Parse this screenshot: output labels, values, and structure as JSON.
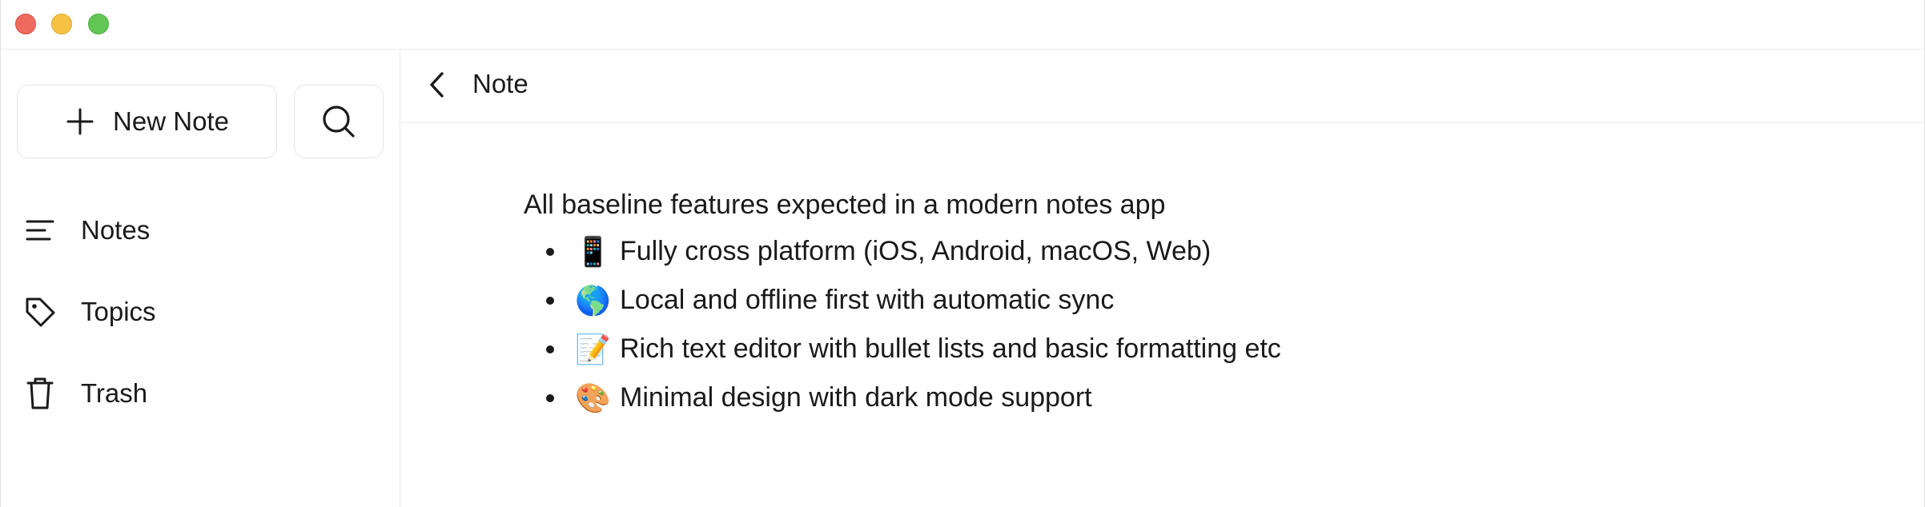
{
  "titlebar": {
    "buttons": [
      "close",
      "minimize",
      "zoom"
    ]
  },
  "sidebar": {
    "new_note_label": "New Note",
    "items": [
      {
        "label": "Notes",
        "icon": "list-icon"
      },
      {
        "label": "Topics",
        "icon": "tag-icon"
      },
      {
        "label": "Trash",
        "icon": "trash-icon"
      }
    ]
  },
  "main": {
    "header_title": "Note",
    "intro": "All baseline features expected in a modern notes app",
    "bullets": [
      {
        "emoji": "📱",
        "text": "Fully cross platform (iOS, Android, macOS, Web)"
      },
      {
        "emoji": "🌎",
        "text": "Local and offline first with automatic sync"
      },
      {
        "emoji": "📝",
        "text": "Rich text editor with bullet lists and basic formatting etc"
      },
      {
        "emoji": "🎨",
        "text": "Minimal design with dark mode support"
      }
    ]
  },
  "colors": {
    "close": "#ee6a5f",
    "minimize": "#f5c243",
    "zoom": "#62c655",
    "border": "#e4e4e4",
    "text": "#1a1a1a"
  }
}
